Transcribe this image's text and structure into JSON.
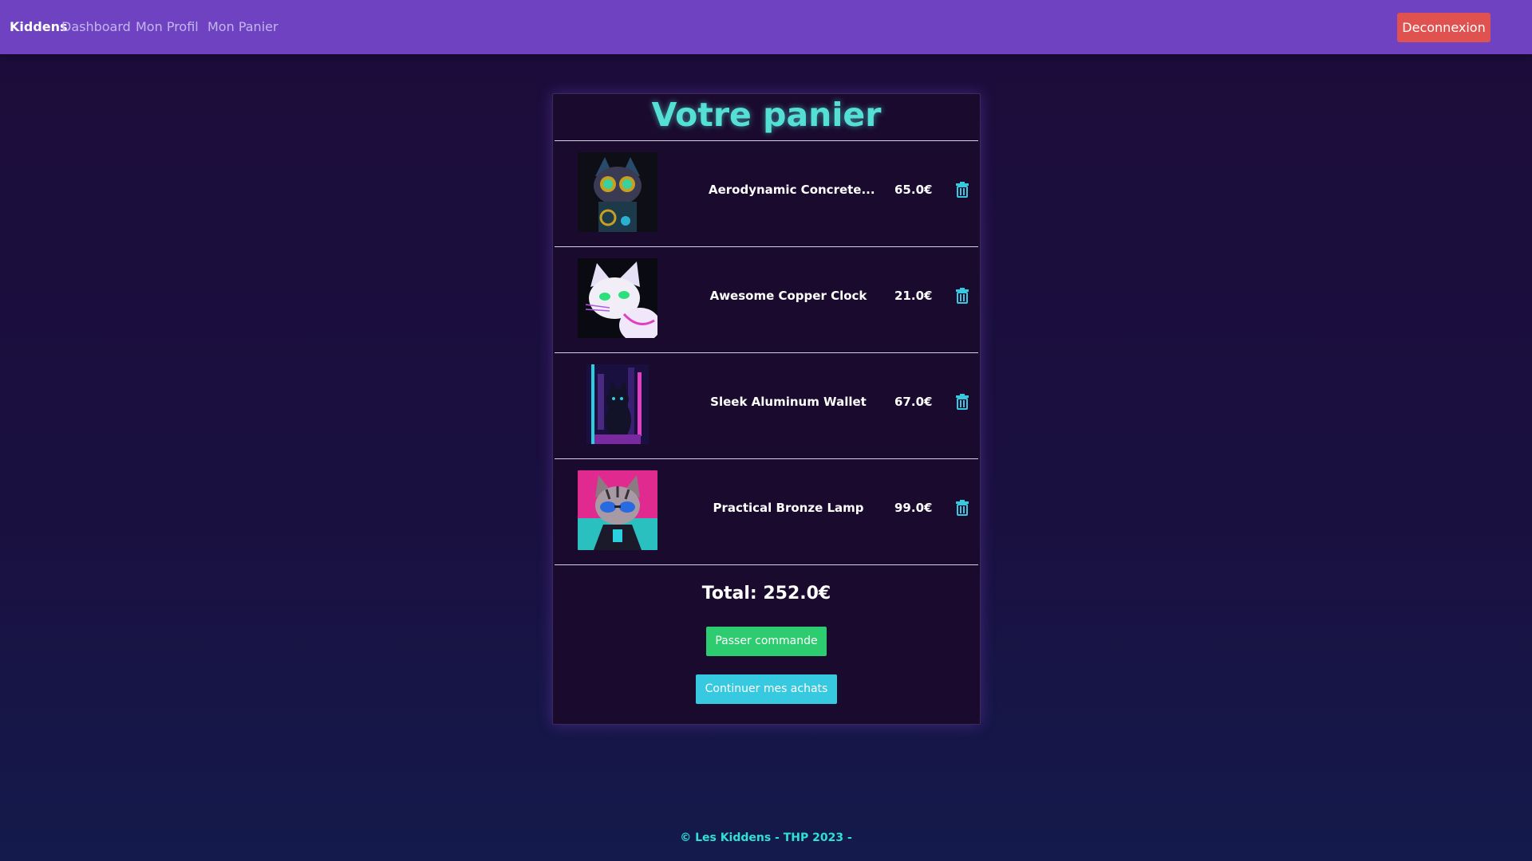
{
  "navbar": {
    "brand": "Kiddens",
    "links": [
      "Dashboard",
      "Mon Profil",
      "Mon Panier"
    ],
    "logout_label": "Deconnexion"
  },
  "cart": {
    "title": "Votre panier",
    "items": [
      {
        "name": "Aerodynamic Concrete...",
        "price": "65.0€",
        "image": "steampunk-cat-with-goggles"
      },
      {
        "name": "Awesome Copper Clock",
        "price": "21.0€",
        "image": "white-neon-cat"
      },
      {
        "name": "Sleek Aluminum Wallet",
        "price": "67.0€",
        "image": "black-cat-neon-city"
      },
      {
        "name": "Practical Bronze Lamp",
        "price": "99.0€",
        "image": "tabby-cat-with-sunglasses"
      }
    ],
    "total": "Total: 252.0€",
    "order_label": "Passer commande",
    "continue_label": "Continuer mes achats"
  },
  "footer": {
    "text": "© Les Kiddens - THP 2023 -"
  },
  "colors": {
    "navbar": "#6f42c1",
    "logout": "#e0524f",
    "title": "#55e0d6",
    "order": "#2ecc71",
    "continue": "#36c9e0",
    "trash": "#36c9e0"
  },
  "icons": {
    "delete": "trash-icon"
  }
}
